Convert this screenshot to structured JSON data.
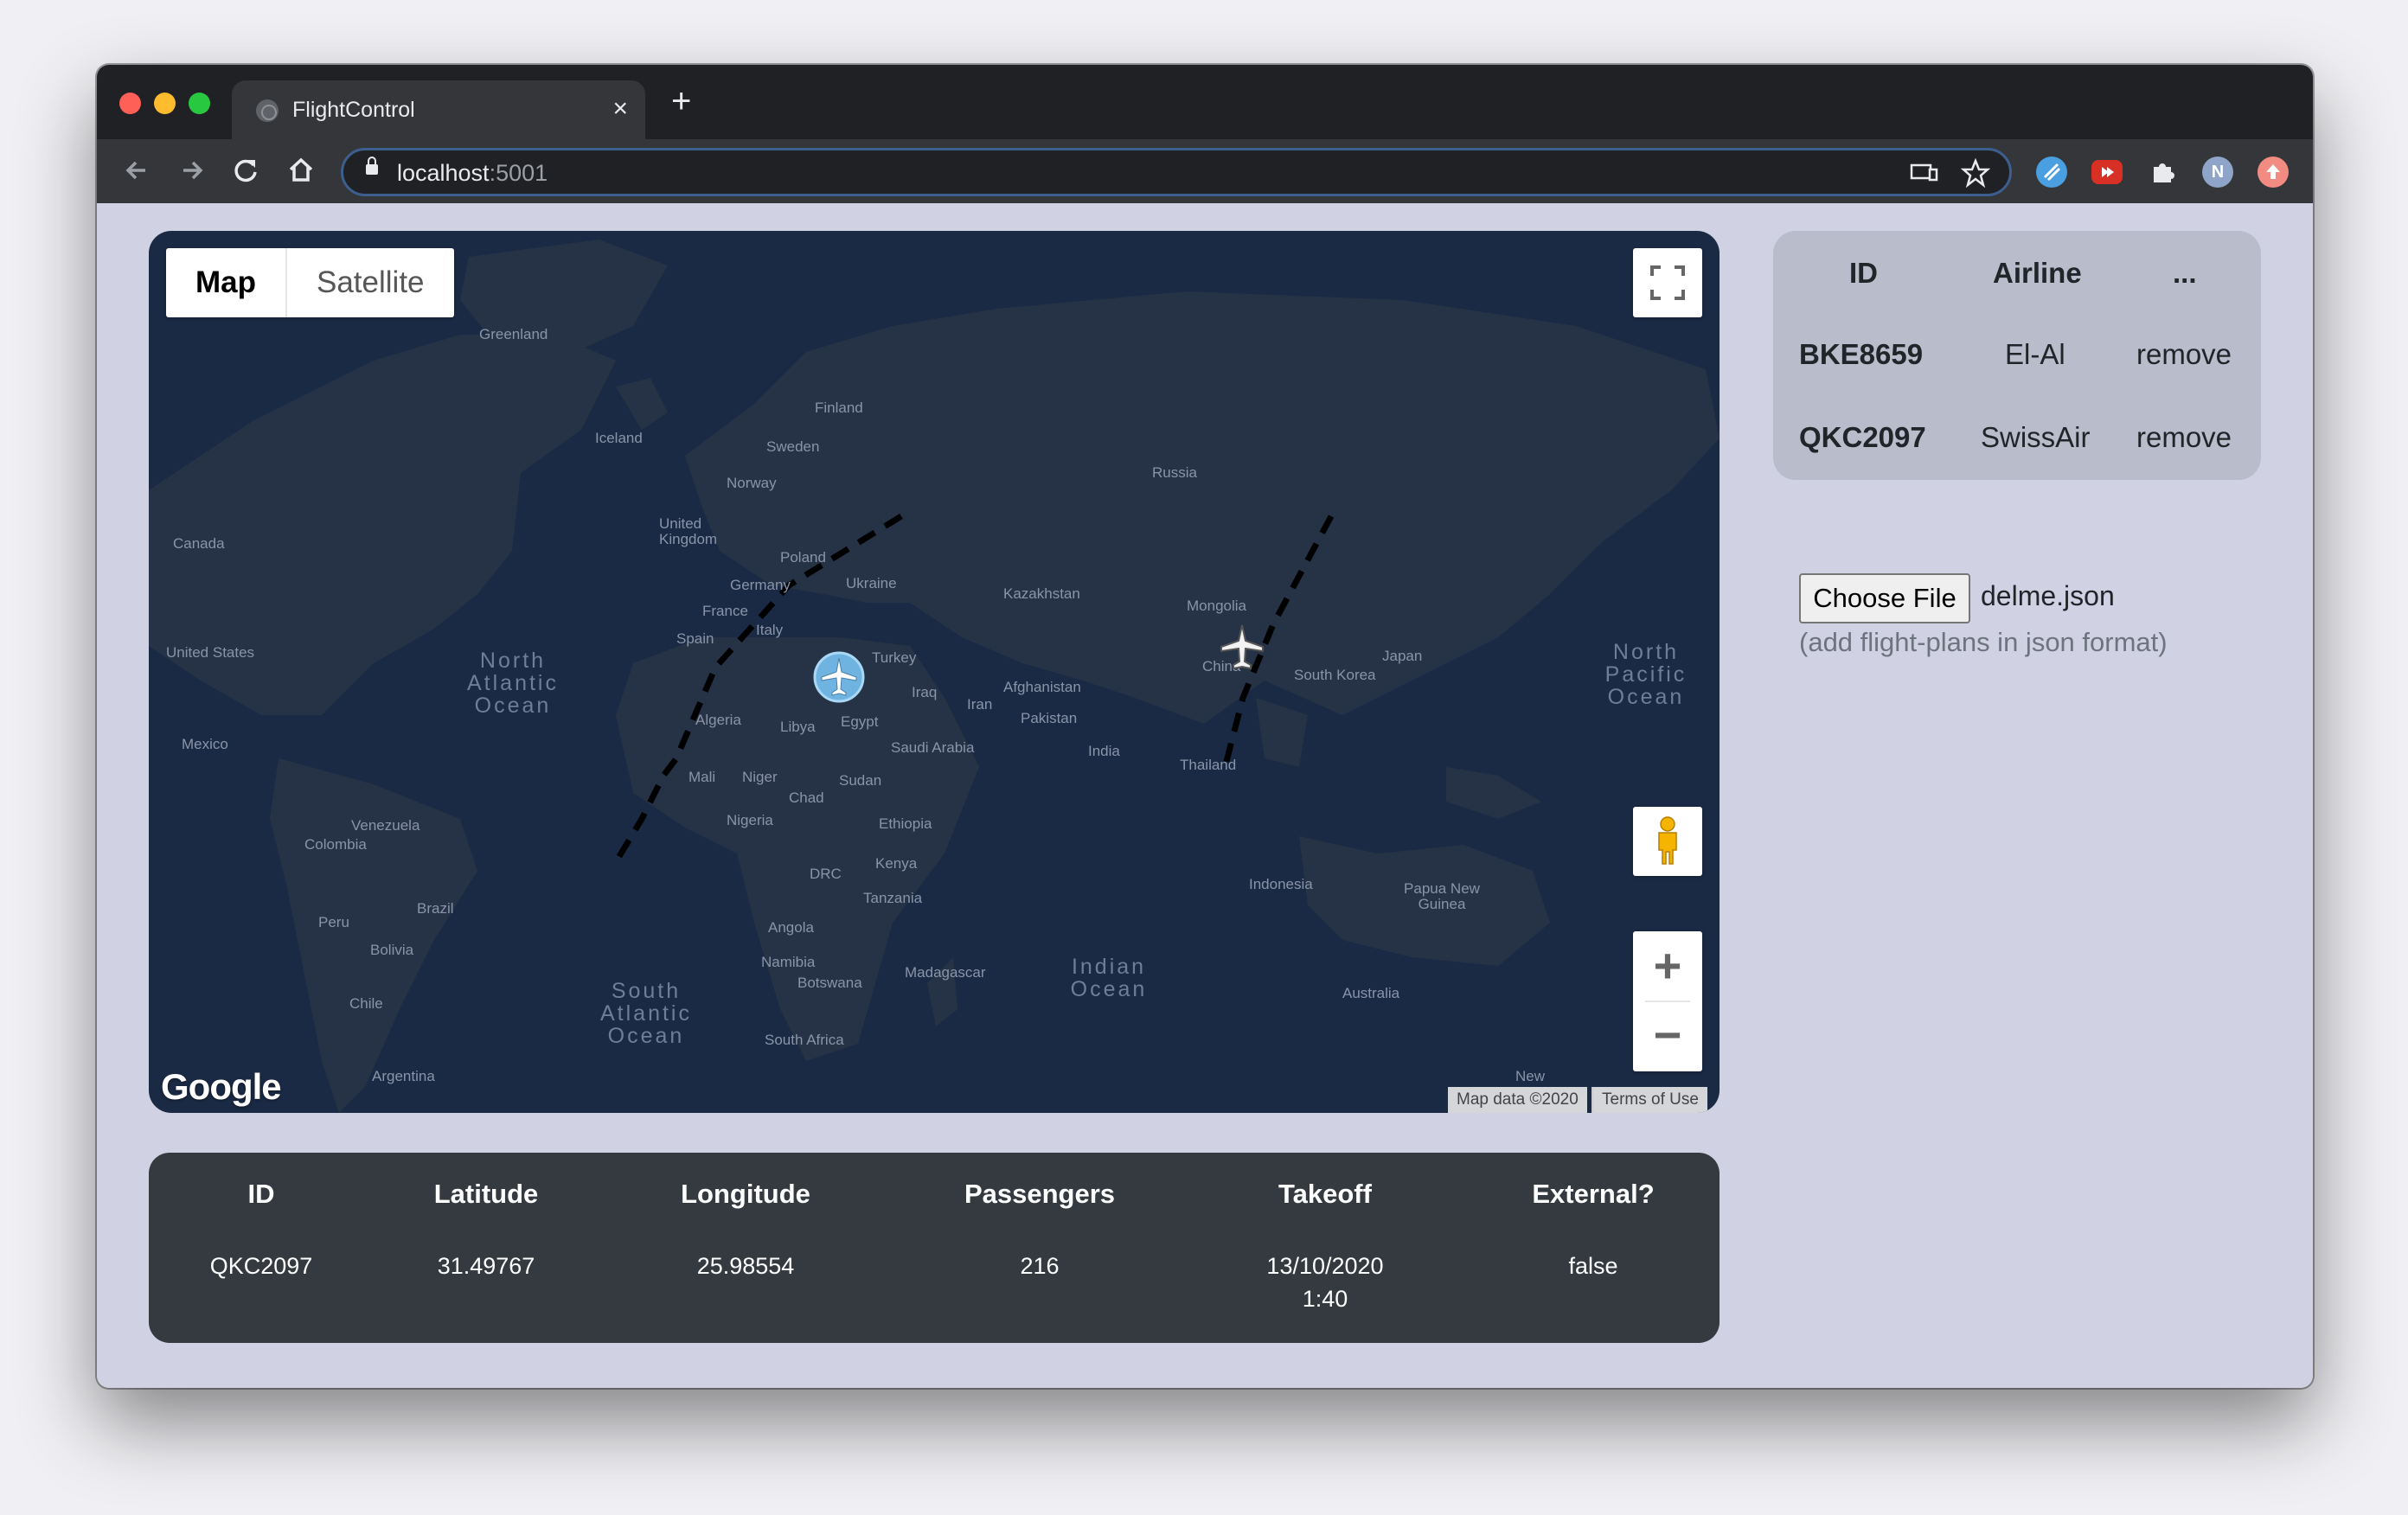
{
  "browser": {
    "tab_title": "FlightControl",
    "tab_close": "×",
    "new_tab": "+",
    "url_host": "localhost",
    "url_port": ":5001",
    "profile_initial": "N"
  },
  "map": {
    "type_map": "Map",
    "type_satellite": "Satellite",
    "logo": "Google",
    "attribution": "Map data ©2020",
    "terms": "Terms of Use",
    "zoom_in": "+",
    "zoom_out": "−",
    "labels": [
      "Greenland",
      "Iceland",
      "Finland",
      "Sweden",
      "Norway",
      "Russia",
      "United Kingdom",
      "Poland",
      "Ukraine",
      "Germany",
      "France",
      "Kazakhstan",
      "Mongolia",
      "Canada",
      "Italy",
      "Spain",
      "Turkey",
      "United States",
      "Japan",
      "South Korea",
      "China",
      "Afghanistan",
      "Iraq",
      "Iran",
      "Algeria",
      "Libya",
      "Egypt",
      "Pakistan",
      "Mexico",
      "Saudi Arabia",
      "India",
      "Mali",
      "Niger",
      "Sudan",
      "Thailand",
      "Chad",
      "Nigeria",
      "Ethiopia",
      "Venezuela",
      "Colombia",
      "Kenya",
      "DRC",
      "Indonesia",
      "Papua New Guinea",
      "Tanzania",
      "Brazil",
      "Peru",
      "Angola",
      "Bolivia",
      "Namibia",
      "Madagascar",
      "Botswana",
      "Australia",
      "Chile",
      "South Africa",
      "Argentina",
      "New"
    ],
    "oceans": [
      "North Atlantic Ocean",
      "North Pacific Ocean",
      "South Atlantic Ocean",
      "Indian Ocean"
    ],
    "colors": {
      "water": "#1b2a44",
      "land": "#263246",
      "route": "#000000"
    },
    "flights_on_map": [
      {
        "id": "QKC2097",
        "selected": true,
        "icon": "airplane-icon"
      },
      {
        "id": "BKE8659",
        "selected": false,
        "icon": "airplane-icon"
      }
    ]
  },
  "flights_table": {
    "headers": {
      "id": "ID",
      "airline": "Airline",
      "more": "..."
    },
    "rows": [
      {
        "id": "BKE8659",
        "airline": "El-Al",
        "action": "remove"
      },
      {
        "id": "QKC2097",
        "airline": "SwissAir",
        "action": "remove"
      }
    ]
  },
  "upload": {
    "button": "Choose File",
    "file_name": "delme.json",
    "hint": "(add flight-plans in json format)"
  },
  "details": {
    "headers": {
      "id": "ID",
      "latitude": "Latitude",
      "longitude": "Longitude",
      "passengers": "Passengers",
      "takeoff": "Takeoff",
      "external": "External?"
    },
    "row": {
      "id": "QKC2097",
      "latitude": "31.49767",
      "longitude": "25.98554",
      "passengers": "216",
      "takeoff_date": "13/10/2020",
      "takeoff_time": "1:40",
      "external": "false"
    }
  }
}
